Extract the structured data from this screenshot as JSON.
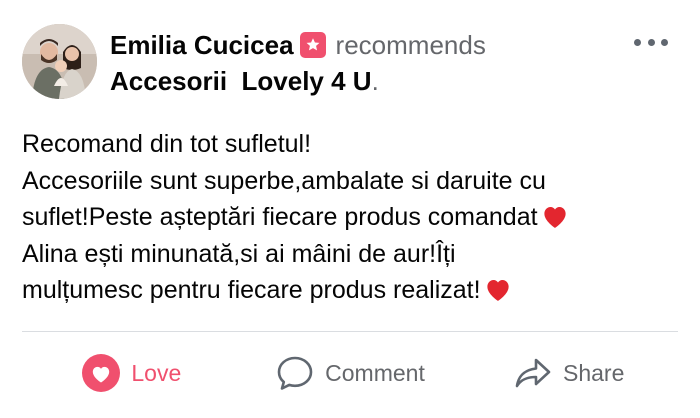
{
  "post": {
    "author": "Emilia Cucicea",
    "action_text": "recommends",
    "page_name": "Accesorii  Lovely 4 U",
    "page_suffix": ".",
    "body_lines": [
      "Recomand din tot sufletul!",
      "Accesoriile sunt superbe,ambalate si daruite cu",
      "suflet!Peste așteptări fiecare produs comandat",
      "Alina ești minunată,si ai mâini de aur!Îți",
      "mulțumesc pentru fiecare produs realizat!"
    ]
  },
  "actions": {
    "love": "Love",
    "comment": "Comment",
    "share": "Share"
  },
  "icons": {
    "recommend": "recommend-star-icon",
    "more": "more-options-icon",
    "heart_emoji": "red-heart-icon",
    "love": "love-icon",
    "comment": "comment-icon",
    "share": "share-icon"
  },
  "colors": {
    "love_accent": "#f0506e",
    "secondary_text": "#65676b",
    "heart_emoji": "#e3262f"
  }
}
